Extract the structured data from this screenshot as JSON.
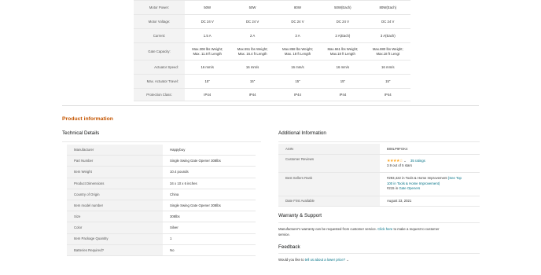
{
  "comparison": {
    "rows": [
      {
        "label": "Motor Power:",
        "cells": [
          "50W",
          "50W",
          "80W",
          "50W(Each)",
          "80W(Each)"
        ]
      },
      {
        "label": "Motor Voltage:",
        "cells": [
          "DC 24 V",
          "DC 24 V",
          "DC 24 V",
          "DC 24 V",
          "DC 24 V"
        ]
      },
      {
        "label": "Current:",
        "cells": [
          "1.5 A",
          "2 A",
          "3 A",
          "2 A(Each)",
          "3 A(Each)"
        ]
      },
      {
        "label": "Gate Capacity:",
        "cells": [
          [
            "Max.308 lbs Weight;",
            "Max. 11.8 ft Length"
          ],
          [
            "Max.551 lbs Weight;",
            "Max. 16.4 ft Length"
          ],
          [
            "Max.858 lbs Weight;",
            "Max. 18 ft Length"
          ],
          [
            "Max.661 lbs Weight;",
            "Max.18 ft Length"
          ],
          [
            "Max.880 lbs Weight;",
            "Max.18 ft Lengt"
          ]
        ]
      },
      {
        "label": "Actuator Speed:",
        "cells": [
          "16 mm/s",
          "16 mm/s",
          "16 mm/s",
          "16 mm/s",
          "16 mm/s"
        ]
      },
      {
        "label": "Max. Actuator Travel:",
        "cells": [
          "15\"",
          "15\"",
          "15\"",
          "15\"",
          "15\""
        ]
      },
      {
        "label": "Protection Class:",
        "cells": [
          "IP44",
          "IP44",
          "IP44",
          "IP44",
          "IP44"
        ]
      }
    ]
  },
  "product_information": {
    "title": "Product information",
    "technical": {
      "title": "Technical Details",
      "rows": [
        {
          "k": "Manufacturer",
          "v": "Happybuy"
        },
        {
          "k": "Part Number",
          "v": "Single Swing Gate Opener 308lbs"
        },
        {
          "k": "Item Weight",
          "v": "10.4 pounds"
        },
        {
          "k": "Product Dimensions",
          "v": "34 x 10 x 6 inches"
        },
        {
          "k": "Country of Origin",
          "v": "China"
        },
        {
          "k": "Item model number",
          "v": "Single Swing Gate Opener 308lbs"
        },
        {
          "k": "Size",
          "v": "308lbs"
        },
        {
          "k": "Color",
          "v": "Silver"
        },
        {
          "k": "Item Package Quantity",
          "v": "1"
        },
        {
          "k": "Batteries Required?",
          "v": "No"
        }
      ]
    },
    "additional": {
      "title": "Additional Information",
      "asin_label": "ASIN",
      "asin": "B08LP9FGK4",
      "reviews_label": "Customer Reviews",
      "stars": "★★★★☆",
      "ratings_link": "35 ratings",
      "rating_text": "3.9 out of 5 stars",
      "rank_label": "Best Sellers Rank",
      "rank_line1": "#293,422 in Tools & Home Improvement",
      "rank_see_top": "(See Top",
      "rank_line2_link": "100 in Tools & Home Improvement)",
      "rank_line3_prefix": "#215 in",
      "rank_line3_link": "Gate Openers",
      "date_label": "Date First Available",
      "date": "August 23, 2021"
    },
    "warranty": {
      "title": "Warranty & Support",
      "text_before": "Manufacturer's warranty can be requested from customer service.",
      "link": "Click here",
      "text_after": "to make a request to customer",
      "text_line2": "service."
    },
    "feedback": {
      "title": "Feedback",
      "prefix": "Would you like to",
      "link": "tell us about a lower price?"
    }
  }
}
